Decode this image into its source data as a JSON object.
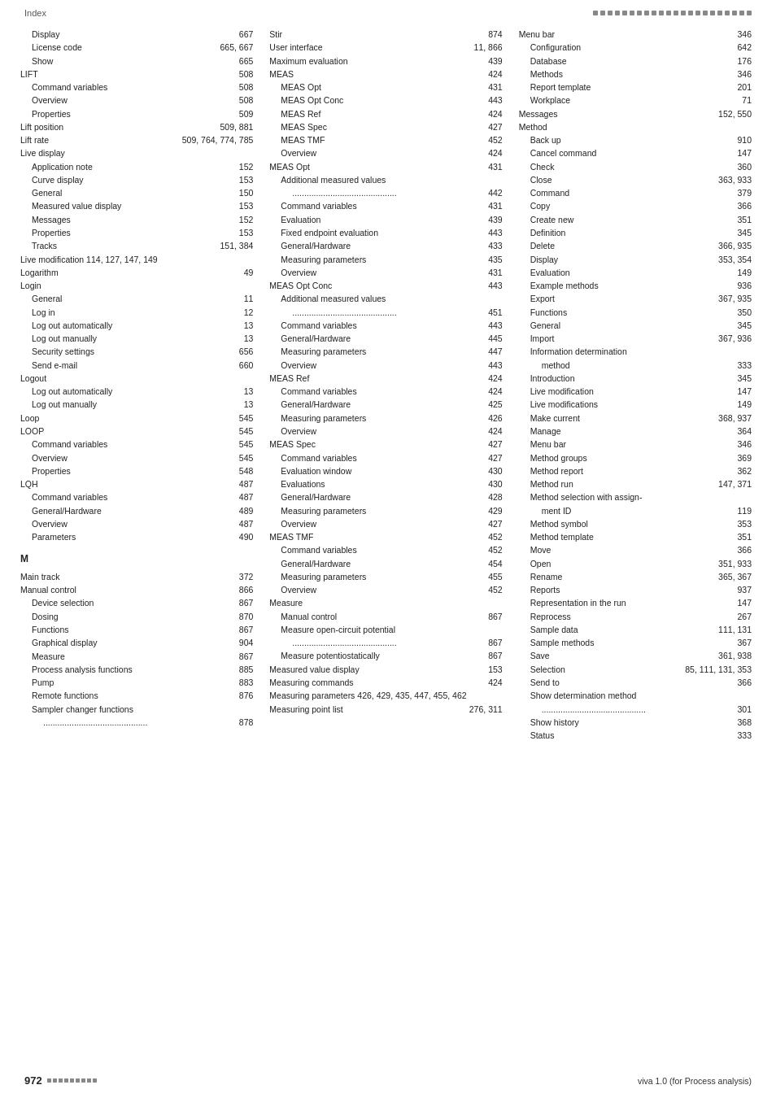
{
  "header": {
    "left_label": "Index",
    "dots_count": 22
  },
  "footer": {
    "page_number": "972",
    "right_label": "viva 1.0 (for Process analysis)"
  },
  "col1": {
    "entries": [
      {
        "label": "Display",
        "page": "667",
        "indent": 1
      },
      {
        "label": "License code",
        "page": "665, 667",
        "indent": 1
      },
      {
        "label": "Show",
        "page": "665",
        "indent": 1
      },
      {
        "label": "LIFT",
        "page": "508",
        "indent": 0
      },
      {
        "label": "Command variables",
        "page": "508",
        "indent": 1
      },
      {
        "label": "Overview",
        "page": "508",
        "indent": 1
      },
      {
        "label": "Properties",
        "page": "509",
        "indent": 1
      },
      {
        "label": "Lift position",
        "page": "509, 881",
        "indent": 0
      },
      {
        "label": "Lift rate",
        "page": "509, 764, 774, 785",
        "indent": 0
      },
      {
        "label": "Live display",
        "page": "",
        "indent": 0
      },
      {
        "label": "Application note",
        "page": "152",
        "indent": 1
      },
      {
        "label": "Curve display",
        "page": "153",
        "indent": 1
      },
      {
        "label": "General",
        "page": "150",
        "indent": 1
      },
      {
        "label": "Measured value display",
        "page": "153",
        "indent": 1
      },
      {
        "label": "Messages",
        "page": "152",
        "indent": 1
      },
      {
        "label": "Properties",
        "page": "153",
        "indent": 1
      },
      {
        "label": "Tracks",
        "page": "151, 384",
        "indent": 1
      },
      {
        "label": "Live modification  114, 127, 147, 149",
        "page": "",
        "indent": 0
      },
      {
        "label": "Logarithm",
        "page": "49",
        "indent": 0
      },
      {
        "label": "Login",
        "page": "",
        "indent": 0
      },
      {
        "label": "General",
        "page": "11",
        "indent": 1
      },
      {
        "label": "Log in",
        "page": "12",
        "indent": 1
      },
      {
        "label": "Log out automatically",
        "page": "13",
        "indent": 1
      },
      {
        "label": "Log out manually",
        "page": "13",
        "indent": 1
      },
      {
        "label": "Security settings",
        "page": "656",
        "indent": 1
      },
      {
        "label": "Send e-mail",
        "page": "660",
        "indent": 1
      },
      {
        "label": "Logout",
        "page": "",
        "indent": 0
      },
      {
        "label": "Log out automatically",
        "page": "13",
        "indent": 1
      },
      {
        "label": "Log out manually",
        "page": "13",
        "indent": 1
      },
      {
        "label": "Loop",
        "page": "545",
        "indent": 0
      },
      {
        "label": "LOOP",
        "page": "545",
        "indent": 0
      },
      {
        "label": "Command variables",
        "page": "545",
        "indent": 1
      },
      {
        "label": "Overview",
        "page": "545",
        "indent": 1
      },
      {
        "label": "Properties",
        "page": "548",
        "indent": 1
      },
      {
        "label": "LQH",
        "page": "487",
        "indent": 0
      },
      {
        "label": "Command variables",
        "page": "487",
        "indent": 1
      },
      {
        "label": "General/Hardware",
        "page": "489",
        "indent": 1
      },
      {
        "label": "Overview",
        "page": "487",
        "indent": 1
      },
      {
        "label": "Parameters",
        "page": "490",
        "indent": 1
      },
      {
        "label": "M",
        "page": "",
        "indent": -1
      },
      {
        "label": "Main track",
        "page": "372",
        "indent": 0
      },
      {
        "label": "Manual control",
        "page": "866",
        "indent": 0
      },
      {
        "label": "Device selection",
        "page": "867",
        "indent": 1
      },
      {
        "label": "Dosing",
        "page": "870",
        "indent": 1
      },
      {
        "label": "Functions",
        "page": "867",
        "indent": 1
      },
      {
        "label": "Graphical display",
        "page": "904",
        "indent": 1
      },
      {
        "label": "Measure",
        "page": "867",
        "indent": 1
      },
      {
        "label": "Process analysis functions",
        "page": "885",
        "indent": 1
      },
      {
        "label": "Pump",
        "page": "883",
        "indent": 1
      },
      {
        "label": "Remote functions",
        "page": "876",
        "indent": 1
      },
      {
        "label": "Sampler changer functions",
        "page": "",
        "indent": 1
      },
      {
        "label": "............................................",
        "page": "878",
        "indent": 2
      }
    ]
  },
  "col2": {
    "entries": [
      {
        "label": "Stir",
        "page": "874",
        "indent": 0
      },
      {
        "label": "User interface",
        "page": "11, 866",
        "indent": 0
      },
      {
        "label": "Maximum evaluation",
        "page": "439",
        "indent": 0
      },
      {
        "label": "MEAS",
        "page": "424",
        "indent": 0
      },
      {
        "label": "MEAS Opt",
        "page": "431",
        "indent": 1
      },
      {
        "label": "MEAS Opt Conc",
        "page": "443",
        "indent": 1
      },
      {
        "label": "MEAS Ref",
        "page": "424",
        "indent": 1
      },
      {
        "label": "MEAS Spec",
        "page": "427",
        "indent": 1
      },
      {
        "label": "MEAS TMF",
        "page": "452",
        "indent": 1
      },
      {
        "label": "Overview",
        "page": "424",
        "indent": 1
      },
      {
        "label": "MEAS Opt",
        "page": "431",
        "indent": 0
      },
      {
        "label": "Additional measured values",
        "page": "",
        "indent": 1
      },
      {
        "label": "............................................",
        "page": "442",
        "indent": 2
      },
      {
        "label": "Command variables",
        "page": "431",
        "indent": 1
      },
      {
        "label": "Evaluation",
        "page": "439",
        "indent": 1
      },
      {
        "label": "Fixed endpoint evaluation",
        "page": "443",
        "indent": 1
      },
      {
        "label": "General/Hardware",
        "page": "433",
        "indent": 1
      },
      {
        "label": "Measuring parameters",
        "page": "435",
        "indent": 1
      },
      {
        "label": "Overview",
        "page": "431",
        "indent": 1
      },
      {
        "label": "MEAS Opt Conc",
        "page": "443",
        "indent": 0
      },
      {
        "label": "Additional measured values",
        "page": "",
        "indent": 1
      },
      {
        "label": "............................................",
        "page": "451",
        "indent": 2
      },
      {
        "label": "Command variables",
        "page": "443",
        "indent": 1
      },
      {
        "label": "General/Hardware",
        "page": "445",
        "indent": 1
      },
      {
        "label": "Measuring parameters",
        "page": "447",
        "indent": 1
      },
      {
        "label": "Overview",
        "page": "443",
        "indent": 1
      },
      {
        "label": "MEAS Ref",
        "page": "424",
        "indent": 0
      },
      {
        "label": "Command variables",
        "page": "424",
        "indent": 1
      },
      {
        "label": "General/Hardware",
        "page": "425",
        "indent": 1
      },
      {
        "label": "Measuring parameters",
        "page": "426",
        "indent": 1
      },
      {
        "label": "Overview",
        "page": "424",
        "indent": 1
      },
      {
        "label": "MEAS Spec",
        "page": "427",
        "indent": 0
      },
      {
        "label": "Command variables",
        "page": "427",
        "indent": 1
      },
      {
        "label": "Evaluation window",
        "page": "430",
        "indent": 1
      },
      {
        "label": "Evaluations",
        "page": "430",
        "indent": 1
      },
      {
        "label": "General/Hardware",
        "page": "428",
        "indent": 1
      },
      {
        "label": "Measuring parameters",
        "page": "429",
        "indent": 1
      },
      {
        "label": "Overview",
        "page": "427",
        "indent": 1
      },
      {
        "label": "MEAS TMF",
        "page": "452",
        "indent": 0
      },
      {
        "label": "Command variables",
        "page": "452",
        "indent": 1
      },
      {
        "label": "General/Hardware",
        "page": "454",
        "indent": 1
      },
      {
        "label": "Measuring parameters",
        "page": "455",
        "indent": 1
      },
      {
        "label": "Overview",
        "page": "452",
        "indent": 1
      },
      {
        "label": "Measure",
        "page": "",
        "indent": 0
      },
      {
        "label": "Manual control",
        "page": "867",
        "indent": 1
      },
      {
        "label": "Measure open-circuit potential",
        "page": "",
        "indent": 1
      },
      {
        "label": "............................................",
        "page": "867",
        "indent": 2
      },
      {
        "label": "Measure potentiostatically",
        "page": "867",
        "indent": 1
      },
      {
        "label": "Measured value display",
        "page": "153",
        "indent": 0
      },
      {
        "label": "Measuring commands",
        "page": "424",
        "indent": 0
      },
      {
        "label": "Measuring parameters  426, 429, 435,  447,  455,  462",
        "page": "",
        "indent": 0
      },
      {
        "label": "Measuring point list",
        "page": "276, 311",
        "indent": 0
      }
    ]
  },
  "col3": {
    "entries": [
      {
        "label": "Menu bar",
        "page": "346",
        "indent": 0
      },
      {
        "label": "Configuration",
        "page": "642",
        "indent": 1
      },
      {
        "label": "Database",
        "page": "176",
        "indent": 1
      },
      {
        "label": "Methods",
        "page": "346",
        "indent": 1
      },
      {
        "label": "Report template",
        "page": "201",
        "indent": 1
      },
      {
        "label": "Workplace",
        "page": "71",
        "indent": 1
      },
      {
        "label": "Messages",
        "page": "152, 550",
        "indent": 0
      },
      {
        "label": "Method",
        "page": "",
        "indent": 0
      },
      {
        "label": "Back up",
        "page": "910",
        "indent": 1
      },
      {
        "label": "Cancel command",
        "page": "147",
        "indent": 1
      },
      {
        "label": "Check",
        "page": "360",
        "indent": 1
      },
      {
        "label": "Close",
        "page": "363, 933",
        "indent": 1
      },
      {
        "label": "Command",
        "page": "379",
        "indent": 1
      },
      {
        "label": "Copy",
        "page": "366",
        "indent": 1
      },
      {
        "label": "Create new",
        "page": "351",
        "indent": 1
      },
      {
        "label": "Definition",
        "page": "345",
        "indent": 1
      },
      {
        "label": "Delete",
        "page": "366, 935",
        "indent": 1
      },
      {
        "label": "Display",
        "page": "353, 354",
        "indent": 1
      },
      {
        "label": "Evaluation",
        "page": "149",
        "indent": 1
      },
      {
        "label": "Example methods",
        "page": "936",
        "indent": 1
      },
      {
        "label": "Export",
        "page": "367, 935",
        "indent": 1
      },
      {
        "label": "Functions",
        "page": "350",
        "indent": 1
      },
      {
        "label": "General",
        "page": "345",
        "indent": 1
      },
      {
        "label": "Import",
        "page": "367, 936",
        "indent": 1
      },
      {
        "label": "Information determination",
        "page": "",
        "indent": 1
      },
      {
        "label": "method",
        "page": "333",
        "indent": 2
      },
      {
        "label": "Introduction",
        "page": "345",
        "indent": 1
      },
      {
        "label": "Live modification",
        "page": "147",
        "indent": 1
      },
      {
        "label": "Live modifications",
        "page": "149",
        "indent": 1
      },
      {
        "label": "Make current",
        "page": "368, 937",
        "indent": 1
      },
      {
        "label": "Manage",
        "page": "364",
        "indent": 1
      },
      {
        "label": "Menu bar",
        "page": "346",
        "indent": 1
      },
      {
        "label": "Method groups",
        "page": "369",
        "indent": 1
      },
      {
        "label": "Method report",
        "page": "362",
        "indent": 1
      },
      {
        "label": "Method run",
        "page": "147, 371",
        "indent": 1
      },
      {
        "label": "Method selection with assign-",
        "page": "",
        "indent": 1
      },
      {
        "label": "ment ID",
        "page": "119",
        "indent": 2
      },
      {
        "label": "Method symbol",
        "page": "353",
        "indent": 1
      },
      {
        "label": "Method template",
        "page": "351",
        "indent": 1
      },
      {
        "label": "Move",
        "page": "366",
        "indent": 1
      },
      {
        "label": "Open",
        "page": "351, 933",
        "indent": 1
      },
      {
        "label": "Rename",
        "page": "365, 367",
        "indent": 1
      },
      {
        "label": "Reports",
        "page": "937",
        "indent": 1
      },
      {
        "label": "Representation in the run",
        "page": "147",
        "indent": 1
      },
      {
        "label": "Reprocess",
        "page": "267",
        "indent": 1
      },
      {
        "label": "Sample data",
        "page": "111, 131",
        "indent": 1
      },
      {
        "label": "Sample methods",
        "page": "367",
        "indent": 1
      },
      {
        "label": "Save",
        "page": "361, 938",
        "indent": 1
      },
      {
        "label": "Selection",
        "page": "85, 111, 131, 353",
        "indent": 1
      },
      {
        "label": "Send to",
        "page": "366",
        "indent": 1
      },
      {
        "label": "Show determination method",
        "page": "",
        "indent": 1
      },
      {
        "label": "............................................",
        "page": "301",
        "indent": 2
      },
      {
        "label": "Show history",
        "page": "368",
        "indent": 1
      },
      {
        "label": "Status",
        "page": "333",
        "indent": 1
      }
    ]
  }
}
